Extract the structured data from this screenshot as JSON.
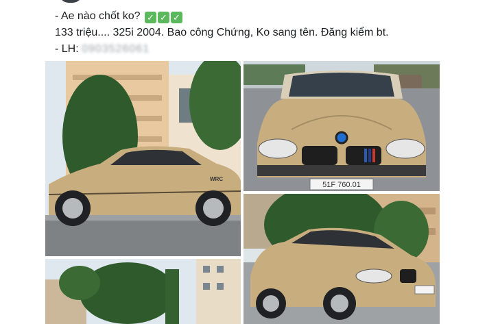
{
  "post": {
    "lines": [
      {
        "text": "- Ae nào chốt ko?",
        "checks": [
          "✓",
          "✓",
          "✓"
        ]
      },
      {
        "text": "133 triệu.... 325i 2004. Bao công Chứng, Ko sang tên. Đăng kiểm bt."
      },
      {
        "prefix": "- LH: ",
        "phone_blurred": "0903526061"
      }
    ],
    "check_color": "#5cb85c"
  },
  "photos": [
    {
      "name": "car-side-view",
      "plate_text": "",
      "badge_text": "WRC"
    },
    {
      "name": "car-front-view",
      "plate_text": "51F 760.01"
    },
    {
      "name": "car-three-quarter-view"
    },
    {
      "name": "trees-and-buildings-view"
    }
  ],
  "colors": {
    "car_body": "#c8ad7f",
    "sky": "#dfe8ee",
    "foliage": "#2f5a2c"
  }
}
